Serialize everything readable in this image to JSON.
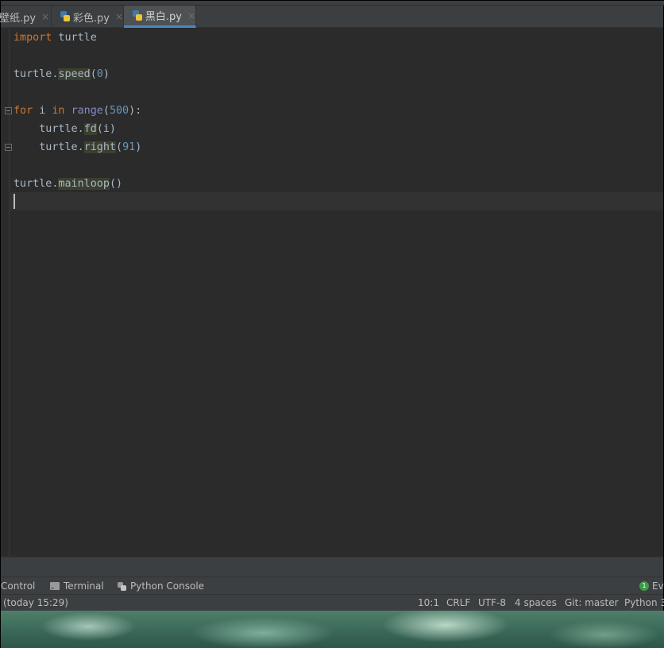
{
  "tabs": [
    {
      "label": "壁纸.py",
      "close": "×"
    },
    {
      "label": "彩色.py",
      "close": "×"
    },
    {
      "label": "黑白.py",
      "close": "×",
      "active": true
    }
  ],
  "code": {
    "line1": {
      "kw": "import",
      "rest": " turtle"
    },
    "line3": {
      "obj": "turtle.",
      "method": "speed",
      "open": "(",
      "num": "0",
      "close": ")"
    },
    "line5": {
      "kw1": "for",
      "var": " i ",
      "kw2": "in",
      "sp": " ",
      "fn": "range",
      "open": "(",
      "num": "500",
      "close": "):"
    },
    "line6": {
      "indent": "    ",
      "obj": "turtle.",
      "method": "fd",
      "args": "(i)"
    },
    "line7": {
      "indent": "    ",
      "obj": "turtle.",
      "method": "right",
      "open": "(",
      "num": "91",
      "close": ")"
    },
    "line9": {
      "obj": "turtle.",
      "method": "mainloop",
      "args": "()"
    }
  },
  "tool_windows": {
    "control": "Control",
    "terminal": "Terminal",
    "python_console": "Python Console",
    "event_badge": "1",
    "event_label": "Ev"
  },
  "status": {
    "vcs_time": "(today 15:29)",
    "position": "10:1",
    "line_sep": "CRLF",
    "encoding": "UTF-8",
    "indent": "4 spaces",
    "git": "Git: master",
    "interpreter": "Python 3"
  },
  "colors": {
    "keyword": "#cc7832",
    "builtin": "#8888c6",
    "number": "#6897bb",
    "text": "#a9b7c6",
    "accent": "#4a88c7"
  }
}
